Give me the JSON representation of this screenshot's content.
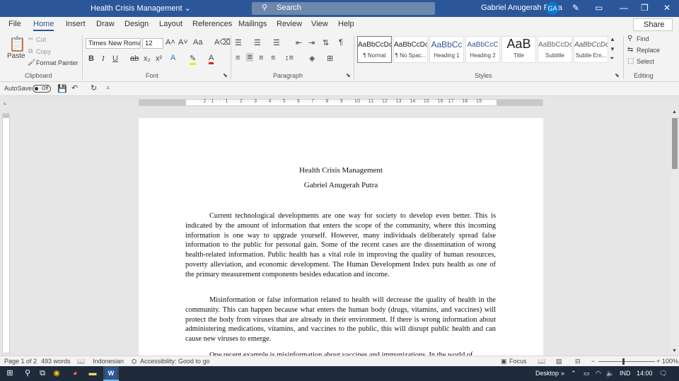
{
  "titlebar": {
    "doc_title": "Health Crisis Management ⌄",
    "search_placeholder": "Search",
    "user_name": "Gabriel Anugerah Putra",
    "user_initials": "GA"
  },
  "tabs": [
    "File",
    "Home",
    "Insert",
    "Draw",
    "Design",
    "Layout",
    "References",
    "Mailings",
    "Review",
    "View",
    "Help"
  ],
  "active_tab": "Home",
  "share_label": "Share",
  "clipboard": {
    "paste": "Paste",
    "cut": "Cut",
    "copy": "Copy",
    "format_painter": "Format Painter",
    "label": "Clipboard"
  },
  "font": {
    "name": "Times New Roma",
    "size": "12",
    "label": "Font"
  },
  "paragraph": {
    "label": "Paragraph"
  },
  "styles": {
    "label": "Styles",
    "items": [
      {
        "preview": "AaBbCcDc",
        "name": "¶ Normal"
      },
      {
        "preview": "AaBbCcDc",
        "name": "¶ No Spac..."
      },
      {
        "preview": "AaBbCc",
        "name": "Heading 1"
      },
      {
        "preview": "AaBbCcC",
        "name": "Heading 2"
      },
      {
        "preview": "AaB",
        "name": "Title"
      },
      {
        "preview": "AaBbCcDc",
        "name": "Subtitle"
      },
      {
        "preview": "AaBbCcDc",
        "name": "Subtle Em..."
      }
    ]
  },
  "editing": {
    "find": "Find",
    "replace": "Replace",
    "select": "Select",
    "label": "Editing"
  },
  "qat": {
    "autosave": "AutoSave",
    "toggle": "Off"
  },
  "ruler": {
    "numbers": "· 2 · 1 · · · 1 · · · 2 · · · 3 · · · 4 · · · 5 · · · 6 · · · 7 · · · 8 · · · 9 · · · 10 · · 11 · · 12 · · 13 · · 14 · · 15 · · 16 · 17 · · 18 · · 19"
  },
  "document": {
    "title": "Health Crisis Management",
    "author": "Gabriel Anugerah Putra",
    "paragraphs": [
      "Current technological developments are one way for society to develop even better. This is indicated by the amount of information that enters the scope of the community, where this incoming information is one way to upgrade yourself. However, many individuals deliberately spread false information to the public for personal gain. Some of the recent cases are the dissemination of wrong health-related information. Public health has a vital role in improving the quality of human resources, poverty alleviation, and economic development. The Human Development Index puts health as one of the primary measurement components besides education and income.",
      "Misinformation or false information related to health will decrease the quality of health in the community. This can happen because what enters the human body (drugs, vitamins, and vaccines) will protect the body from viruses that are already in their environment. If there is wrong information about administering medications, vitamins, and vaccines to the public, this will disrupt public health and can cause new viruses to emerge.",
      "One recent example is misinformation about vaccines and immunizations. In the world of"
    ]
  },
  "status": {
    "page": "Page 1 of 2",
    "words": "493 words",
    "language": "Indonesian",
    "accessibility": "Accessibility: Good to go",
    "focus": "Focus",
    "zoom": "100%"
  },
  "taskbar": {
    "desktop": "Desktop",
    "lang": "IND",
    "time": "14:00"
  },
  "colors": {
    "word_blue": "#2b579a",
    "avatar_blue": "#0a78d4",
    "taskbar": "#1f2a3a"
  }
}
